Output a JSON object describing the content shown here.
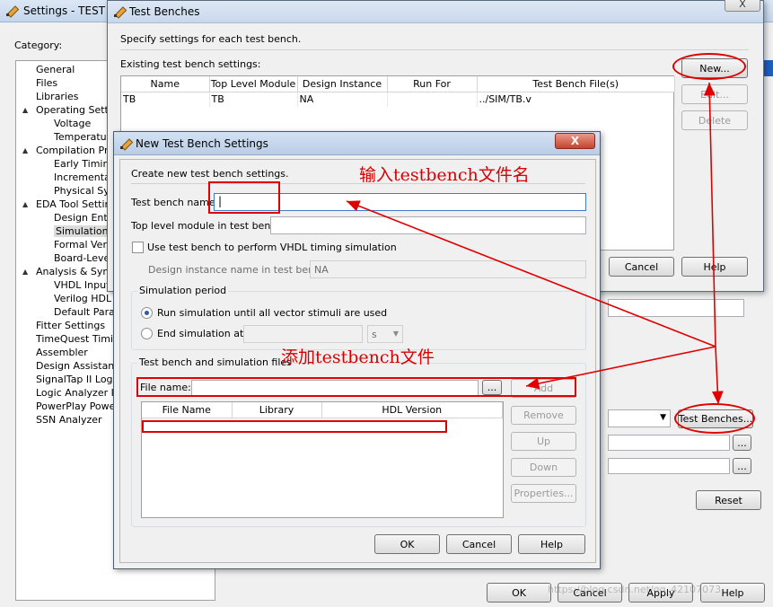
{
  "settings_window": {
    "title": "Settings - TEST",
    "category_label": "Category:",
    "categories": [
      {
        "label": "General",
        "level": 0,
        "expander": ""
      },
      {
        "label": "Files",
        "level": 0,
        "expander": ""
      },
      {
        "label": "Libraries",
        "level": 0,
        "expander": ""
      },
      {
        "label": "Operating Setti",
        "level": 0,
        "expander": "▲"
      },
      {
        "label": "Voltage",
        "level": 1,
        "expander": ""
      },
      {
        "label": "Temperatur",
        "level": 1,
        "expander": ""
      },
      {
        "label": "Compilation Pro",
        "level": 0,
        "expander": "▲"
      },
      {
        "label": "Early Timing",
        "level": 1,
        "expander": ""
      },
      {
        "label": "Incremental",
        "level": 1,
        "expander": ""
      },
      {
        "label": "Physical Syn",
        "level": 1,
        "expander": ""
      },
      {
        "label": "EDA Tool Settin",
        "level": 0,
        "expander": "▲"
      },
      {
        "label": "Design Entr",
        "level": 1,
        "expander": ""
      },
      {
        "label": "Simulation",
        "level": 1,
        "expander": "",
        "selected": true
      },
      {
        "label": "Formal Verifi",
        "level": 1,
        "expander": ""
      },
      {
        "label": "Board-Leve",
        "level": 1,
        "expander": ""
      },
      {
        "label": "Analysis & Synt",
        "level": 0,
        "expander": "▲"
      },
      {
        "label": "VHDL Input",
        "level": 1,
        "expander": ""
      },
      {
        "label": "Verilog HDL In",
        "level": 1,
        "expander": ""
      },
      {
        "label": "Default Param",
        "level": 1,
        "expander": ""
      },
      {
        "label": "Fitter Settings",
        "level": 0,
        "expander": ""
      },
      {
        "label": "TimeQuest Timing",
        "level": 0,
        "expander": ""
      },
      {
        "label": "Assembler",
        "level": 0,
        "expander": ""
      },
      {
        "label": "Design Assistant",
        "level": 0,
        "expander": ""
      },
      {
        "label": "SignalTap II Logic",
        "level": 0,
        "expander": ""
      },
      {
        "label": "Logic Analyzer Int",
        "level": 0,
        "expander": ""
      },
      {
        "label": "PowerPlay Power",
        "level": 0,
        "expander": ""
      },
      {
        "label": "SSN Analyzer",
        "level": 0,
        "expander": ""
      }
    ],
    "test_benches_button": "Test Benches...",
    "browse_label": "...",
    "reset_button": "Reset",
    "ok_button": "OK",
    "cancel_button": "Cancel",
    "apply_button": "Apply",
    "help_button": "Help",
    "watermark": "https://blog.csdn.net/qq_42107073"
  },
  "test_benches_dialog": {
    "title": "Test Benches",
    "close_label": "X",
    "description": "Specify settings for each test bench.",
    "existing_label": "Existing test bench settings:",
    "columns": [
      "Name",
      "Top Level Module",
      "Design Instance",
      "Run For",
      "Test Bench File(s)"
    ],
    "rows": [
      {
        "name": "TB",
        "top": "TB",
        "instance": "NA",
        "run_for": "",
        "files": "../SIM/TB.v"
      }
    ],
    "new_button": "New...",
    "edit_button": "Edit...",
    "delete_button": "Delete",
    "cancel_button": "Cancel",
    "help_button": "Help"
  },
  "new_tb_dialog": {
    "title": "New Test Bench Settings",
    "close_label": "X",
    "create_label": "Create new test bench settings.",
    "name_label": "Test bench name:",
    "name_value": "|",
    "top_label": "Top level module in test bench:",
    "top_value": "",
    "vhdl_checkbox": "Use test bench to perform VHDL timing simulation",
    "instance_label": "Design instance name in test bench:",
    "instance_value": "NA",
    "period_group": "Simulation period",
    "run_all": "Run simulation until all vector stimuli are used",
    "end_at": "End simulation at:",
    "time_unit": "s",
    "files_group": "Test bench and simulation files",
    "file_name_label": "File name:",
    "browse_label": "...",
    "add_button": "Add",
    "file_columns": [
      "File Name",
      "Library",
      "HDL Version"
    ],
    "remove_button": "Remove",
    "up_button": "Up",
    "down_button": "Down",
    "properties_button": "Properties...",
    "ok_button": "OK",
    "cancel_button": "Cancel",
    "help_button": "Help"
  },
  "annotations": {
    "input_name_note": "输入testbench文件名",
    "add_file_note": "添加testbench文件",
    "color": "#e00000"
  }
}
